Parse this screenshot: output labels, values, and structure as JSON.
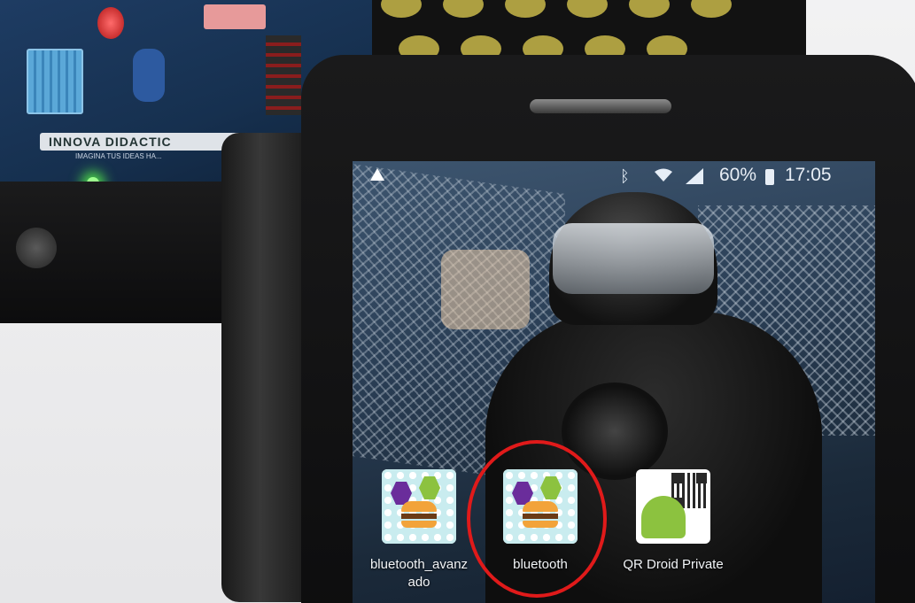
{
  "board": {
    "brand": "INNOVA DIDACTIC",
    "brand_sub": "IMAGINA TUS IDEAS HA..."
  },
  "status_bar": {
    "battery": "60%",
    "time": "17:05",
    "icons": [
      "warning-icon",
      "bluetooth-icon",
      "wifi-icon",
      "signal-icon",
      "battery-icon"
    ]
  },
  "apps": [
    {
      "label": "bluetooth_avanz ado",
      "icon": "app-inventor-icon"
    },
    {
      "label": "bluetooth",
      "icon": "app-inventor-icon",
      "highlighted": true
    },
    {
      "label": "QR Droid Private",
      "icon": "qr-droid-icon"
    }
  ],
  "colors": {
    "highlight": "#e01a1a",
    "led_green": "#4fe04a"
  }
}
